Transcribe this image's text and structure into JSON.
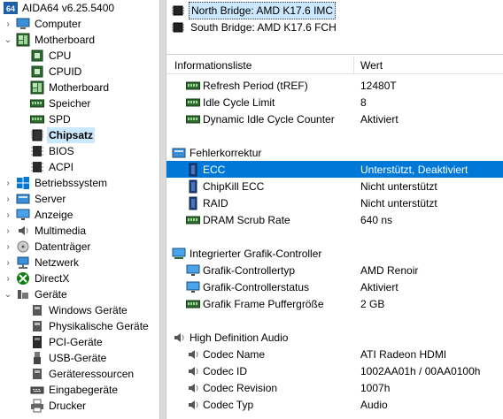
{
  "app": {
    "title": "AIDA64 v6.25.5400",
    "logo": "64"
  },
  "tree": {
    "items": [
      {
        "label": "AIDA64 v6.25.5400",
        "indent": 0,
        "expander": "",
        "icon": "aida64-logo-icon"
      },
      {
        "label": "Computer",
        "indent": 0,
        "expander": "›",
        "icon": "computer-icon"
      },
      {
        "label": "Motherboard",
        "indent": 0,
        "expander": "⌄",
        "icon": "motherboard-icon"
      },
      {
        "label": "CPU",
        "indent": 1,
        "expander": "",
        "icon": "cpu-icon"
      },
      {
        "label": "CPUID",
        "indent": 1,
        "expander": "",
        "icon": "cpuid-icon"
      },
      {
        "label": "Motherboard",
        "indent": 1,
        "expander": "",
        "icon": "motherboard-icon"
      },
      {
        "label": "Speicher",
        "indent": 1,
        "expander": "",
        "icon": "memory-icon"
      },
      {
        "label": "SPD",
        "indent": 1,
        "expander": "",
        "icon": "spd-icon"
      },
      {
        "label": "Chipsatz",
        "indent": 1,
        "expander": "",
        "icon": "chipset-icon",
        "selected": true
      },
      {
        "label": "BIOS",
        "indent": 1,
        "expander": "",
        "icon": "bios-icon"
      },
      {
        "label": "ACPI",
        "indent": 1,
        "expander": "",
        "icon": "acpi-icon"
      },
      {
        "label": "Betriebssystem",
        "indent": 0,
        "expander": "›",
        "icon": "windows-icon"
      },
      {
        "label": "Server",
        "indent": 0,
        "expander": "›",
        "icon": "server-icon"
      },
      {
        "label": "Anzeige",
        "indent": 0,
        "expander": "›",
        "icon": "display-icon"
      },
      {
        "label": "Multimedia",
        "indent": 0,
        "expander": "›",
        "icon": "speaker-icon"
      },
      {
        "label": "Datenträger",
        "indent": 0,
        "expander": "›",
        "icon": "disk-icon"
      },
      {
        "label": "Netzwerk",
        "indent": 0,
        "expander": "›",
        "icon": "network-icon"
      },
      {
        "label": "DirectX",
        "indent": 0,
        "expander": "›",
        "icon": "directx-icon"
      },
      {
        "label": "Geräte",
        "indent": 0,
        "expander": "⌄",
        "icon": "devices-icon"
      },
      {
        "label": "Windows Geräte",
        "indent": 1,
        "expander": "",
        "icon": "windows-devices-icon"
      },
      {
        "label": "Physikalische Geräte",
        "indent": 1,
        "expander": "",
        "icon": "physical-devices-icon"
      },
      {
        "label": "PCI-Geräte",
        "indent": 1,
        "expander": "",
        "icon": "pci-icon"
      },
      {
        "label": "USB-Geräte",
        "indent": 1,
        "expander": "",
        "icon": "usb-icon"
      },
      {
        "label": "Geräteressourcen",
        "indent": 1,
        "expander": "",
        "icon": "resources-icon"
      },
      {
        "label": "Eingabegeräte",
        "indent": 1,
        "expander": "",
        "icon": "keyboard-icon"
      },
      {
        "label": "Drucker",
        "indent": 1,
        "expander": "",
        "icon": "printer-icon"
      }
    ]
  },
  "devices": [
    {
      "label": "North Bridge: AMD K17.6 IMC",
      "selected": true,
      "icon": "chip-icon"
    },
    {
      "label": "South Bridge: AMD K17.6 FCH",
      "selected": false,
      "icon": "chip-icon"
    }
  ],
  "columns": {
    "field": "Informationsliste",
    "value": "Wert"
  },
  "rows": [
    {
      "kind": "item",
      "icon": "memory-icon",
      "field": "Refresh Period (tREF)",
      "value": "12480T"
    },
    {
      "kind": "item",
      "icon": "memory-icon",
      "field": "Idle Cycle Limit",
      "value": "8"
    },
    {
      "kind": "item",
      "icon": "memory-icon",
      "field": "Dynamic Idle Cycle Counter",
      "value": "Aktiviert"
    },
    {
      "kind": "blank"
    },
    {
      "kind": "section",
      "icon": "error-correction-icon",
      "field": "Fehlerkorrektur"
    },
    {
      "kind": "item",
      "icon": "ecc-chip-icon",
      "field": "ECC",
      "value": "Unterstützt, Deaktiviert",
      "selected": true
    },
    {
      "kind": "item",
      "icon": "ecc-chip-icon",
      "field": "ChipKill ECC",
      "value": "Nicht unterstützt"
    },
    {
      "kind": "item",
      "icon": "ecc-chip-icon",
      "field": "RAID",
      "value": "Nicht unterstützt"
    },
    {
      "kind": "item",
      "icon": "memory-icon",
      "field": "DRAM Scrub Rate",
      "value": "640 ns"
    },
    {
      "kind": "blank"
    },
    {
      "kind": "section",
      "icon": "graphics-controller-icon",
      "field": "Integrierter Grafik-Controller"
    },
    {
      "kind": "item",
      "icon": "monitor-icon",
      "field": "Grafik-Controllertyp",
      "value": "AMD Renoir"
    },
    {
      "kind": "item",
      "icon": "monitor-icon",
      "field": "Grafik-Controllerstatus",
      "value": "Aktiviert"
    },
    {
      "kind": "item",
      "icon": "memory-icon",
      "field": "Grafik Frame Puffergröße",
      "value": "2 GB"
    },
    {
      "kind": "blank"
    },
    {
      "kind": "section",
      "icon": "speaker-icon",
      "field": "High Definition Audio"
    },
    {
      "kind": "item",
      "icon": "speaker-icon",
      "field": "Codec Name",
      "value": "ATI Radeon HDMI"
    },
    {
      "kind": "item",
      "icon": "speaker-icon",
      "field": "Codec ID",
      "value": "1002AA01h / 00AA0100h"
    },
    {
      "kind": "item",
      "icon": "speaker-icon",
      "field": "Codec Revision",
      "value": "1007h"
    },
    {
      "kind": "item",
      "icon": "speaker-icon",
      "field": "Codec Typ",
      "value": "Audio"
    }
  ],
  "colors": {
    "selection": "#0078d7",
    "tree_selection": "#cce8ff",
    "ram_green": "#2e6b2e"
  }
}
